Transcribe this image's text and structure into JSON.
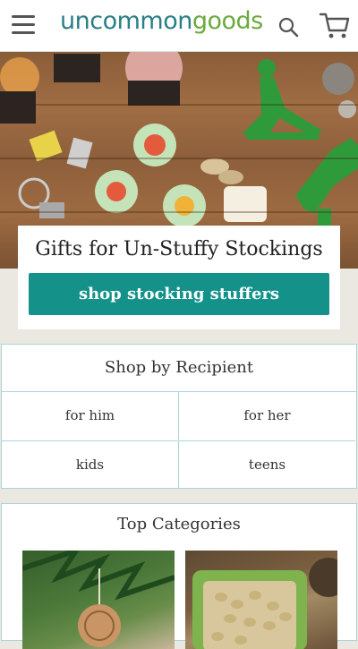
{
  "header": {
    "logo_part1": "uncommon",
    "logo_part2": "goods",
    "menu_icon": "hamburger-menu-icon",
    "search_icon": "search-icon",
    "cart_icon": "cart-icon"
  },
  "hero": {
    "promo_title": "Gifts for Un-Stuffy Stockings",
    "promo_button": "shop stocking stuffers"
  },
  "recipient": {
    "title": "Shop by Recipient",
    "items": [
      {
        "label": "for him"
      },
      {
        "label": "for her"
      },
      {
        "label": "kids"
      },
      {
        "label": "teens"
      }
    ]
  },
  "categories": {
    "title": "Top Categories"
  },
  "colors": {
    "brand_teal": "#2a7f86",
    "brand_green": "#6aaa3e",
    "button_teal": "#14928a",
    "card_border": "#a9d5db"
  }
}
